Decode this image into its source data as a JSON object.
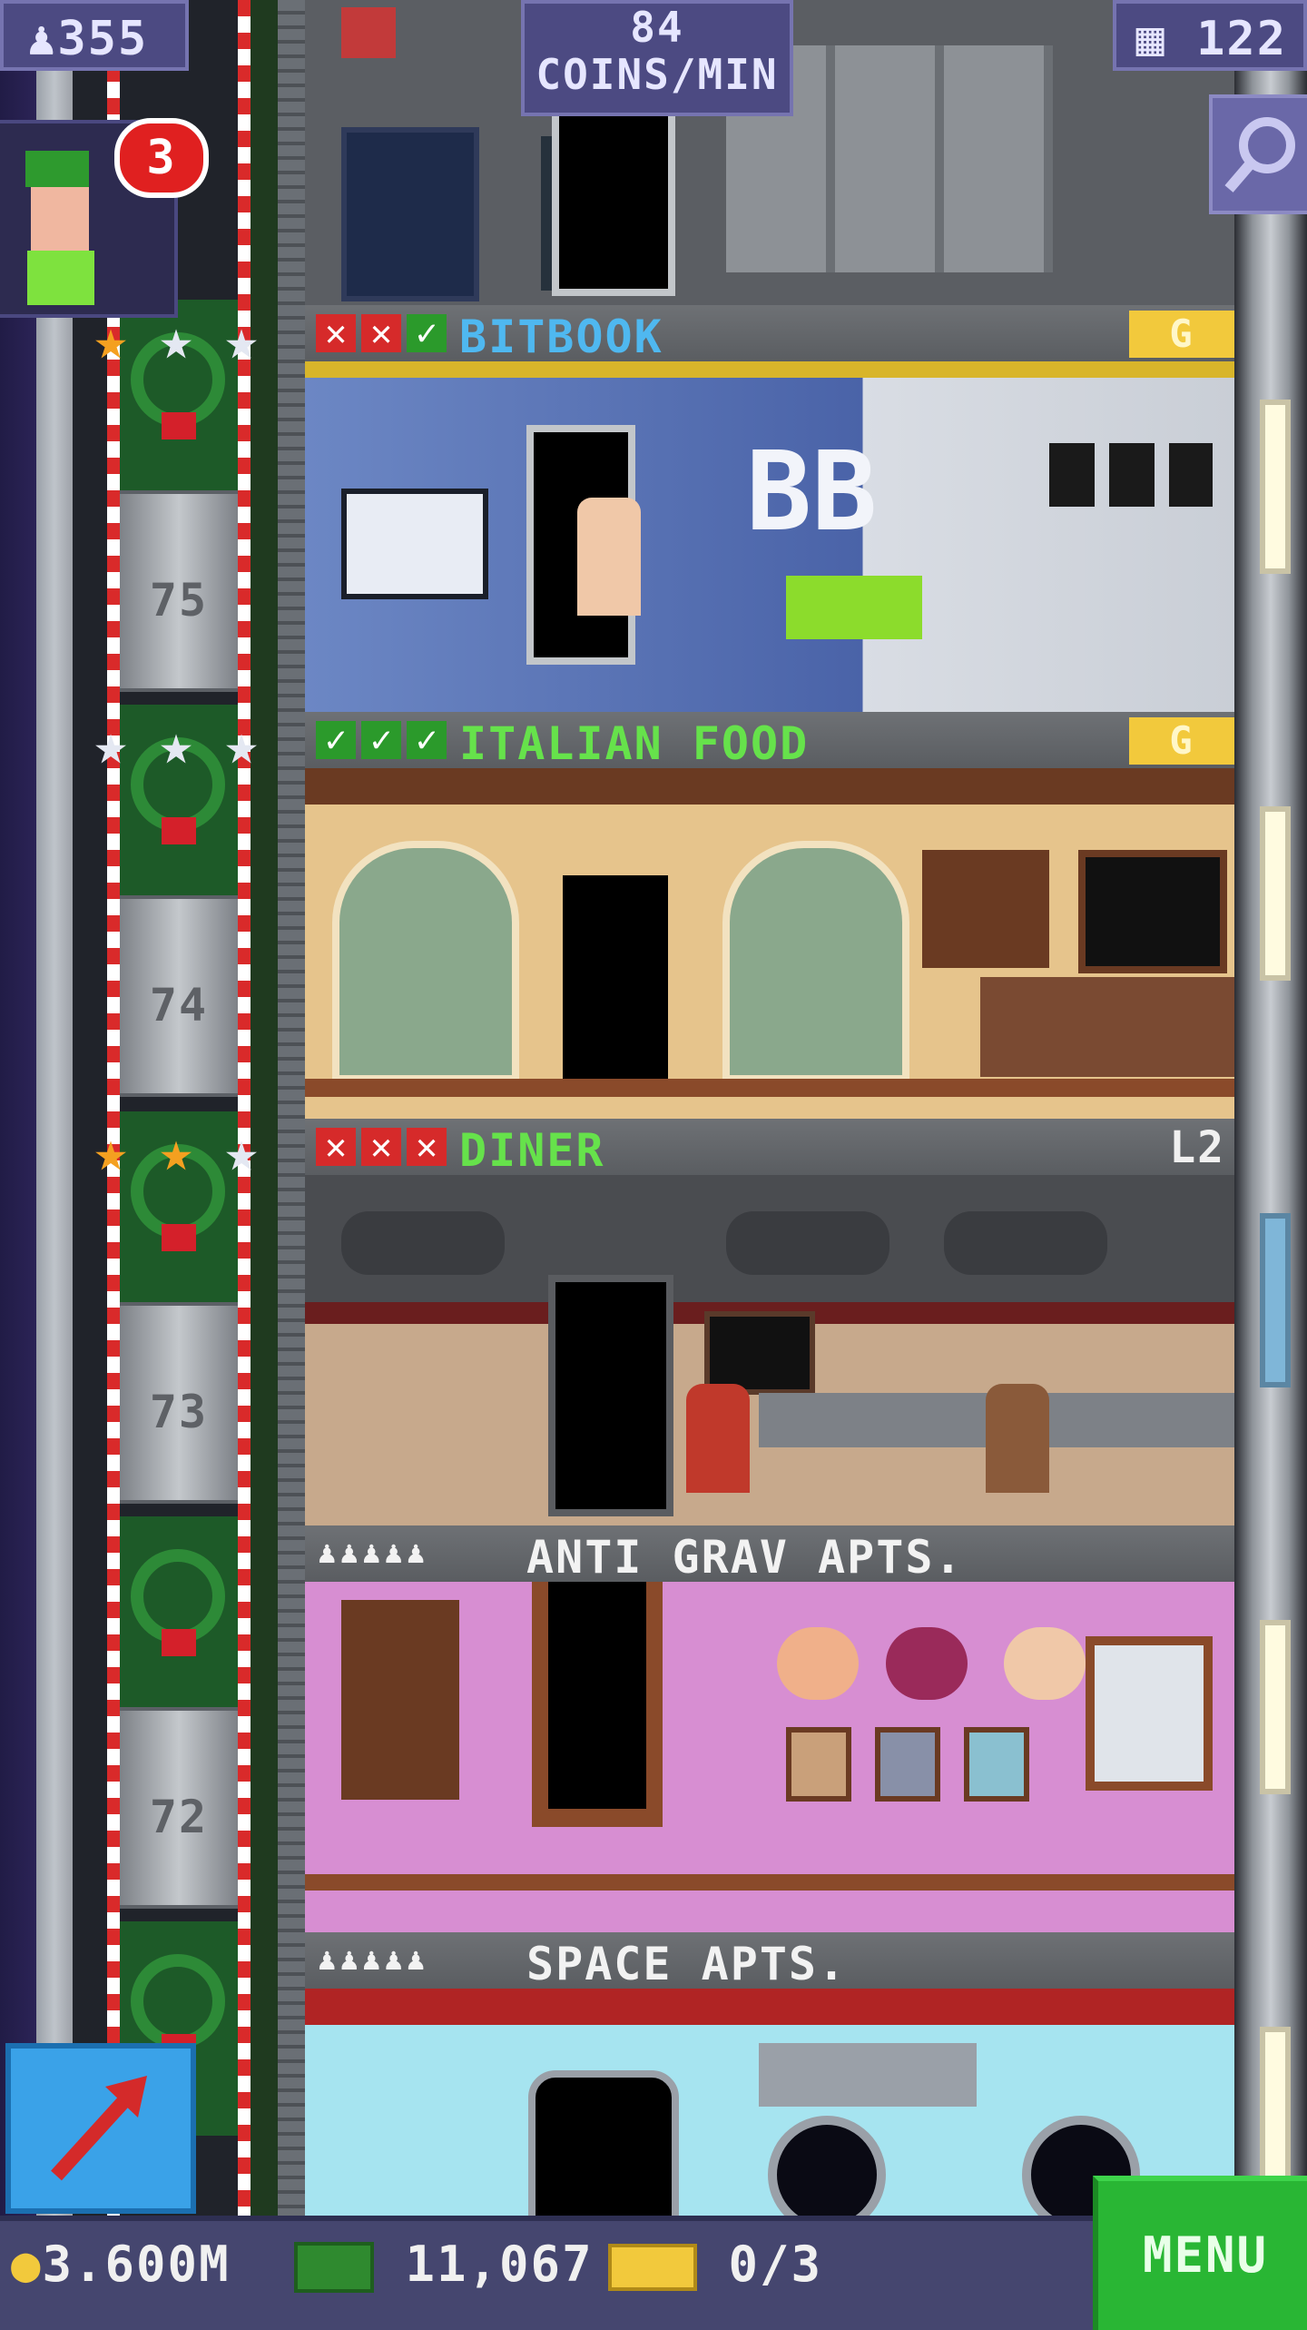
{
  "hud": {
    "population": "355",
    "coins_per_min_value": "84",
    "coins_per_min_unit": "COINS/MIN",
    "floor_count": "122",
    "visitor_count": "3"
  },
  "floors": [
    {
      "name": "BITBOOK",
      "checks": [
        "fail",
        "fail",
        "pass"
      ],
      "badge": "G",
      "color": "#4fb8f0",
      "room_sign": "BB"
    },
    {
      "name": "ITALIAN FOOD",
      "checks": [
        "pass",
        "pass",
        "pass"
      ],
      "badge": "G",
      "color": "#66e24b"
    },
    {
      "name": "DINER",
      "checks": [
        "fail",
        "fail",
        "fail"
      ],
      "level": "L2",
      "color": "#66e24b"
    },
    {
      "name": "ANTI GRAV APTS.",
      "residents_icon": "person-icons",
      "color": "#f2f2f2"
    },
    {
      "name": "SPACE APTS.",
      "residents_icon": "person-icons",
      "color": "#f2f2f2"
    }
  ],
  "elevator": {
    "floor_numbers": [
      "75",
      "74",
      "73",
      "72"
    ],
    "stars": [
      [
        "gold",
        "silver",
        "silver"
      ],
      [
        "silver",
        "silver",
        "silver"
      ],
      [
        "gold",
        "gold",
        "silver"
      ]
    ]
  },
  "bottom": {
    "coins": "3.600M",
    "bux": "11,067",
    "tickets": "0/3",
    "menu_label": "MENU"
  },
  "colors": {
    "hud_bg": "#4c4a82",
    "menu_green": "#29b634",
    "gold": "#f2c93c"
  }
}
